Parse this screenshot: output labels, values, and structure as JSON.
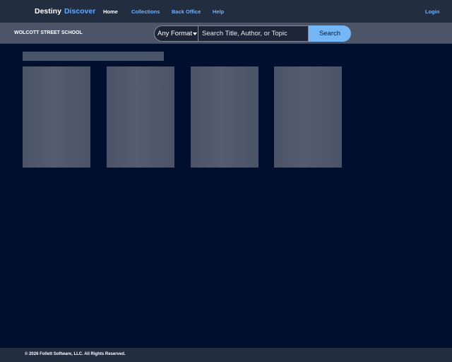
{
  "header": {
    "brand_primary": "Destiny",
    "brand_accent": "Discover",
    "nav": [
      {
        "label": "Home",
        "active": true
      },
      {
        "label": "Collections",
        "active": false
      },
      {
        "label": "Back Office",
        "active": false
      },
      {
        "label": "Help",
        "active": false
      }
    ],
    "login_label": "Login"
  },
  "search": {
    "school_name": "WOLCOTT STREET SCHOOL",
    "format_selected": "Any Format",
    "placeholder": "Search Title, Author, or Topic",
    "value": "",
    "button_label": "Search"
  },
  "footer": {
    "copyright": "© 2026 Follett Software, LLC. All Rights Reserved."
  },
  "colors": {
    "page_background": "#000f2d",
    "header_background": "#232d40",
    "search_bar_background": "#4c5568",
    "link": "#6db0ff",
    "search_button": "#74b6f6"
  }
}
